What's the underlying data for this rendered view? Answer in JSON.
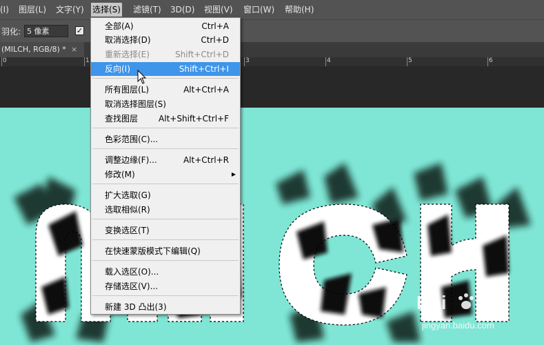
{
  "menubar": {
    "items": [
      "(I)",
      "图层(L)",
      "文字(Y)",
      "选择(S)",
      "滤镜(T)",
      "3D(D)",
      "视图(V)",
      "窗口(W)",
      "帮助(H)"
    ],
    "active": "选择(S)"
  },
  "options": {
    "feather_label": "羽化:",
    "feather_value": "5 像素"
  },
  "tab": {
    "title": "(MILCH, RGB/8) *",
    "close": "×"
  },
  "ruler": {
    "labels": [
      "0",
      "1",
      "2",
      "3",
      "4",
      "5",
      "6"
    ]
  },
  "select_menu": {
    "items": [
      {
        "label": "全部(A)",
        "shortcut": "Ctrl+A"
      },
      {
        "label": "取消选择(D)",
        "shortcut": "Ctrl+D"
      },
      {
        "label": "重新选择(E)",
        "shortcut": "Shift+Ctrl+D"
      },
      {
        "label": "反向(I)",
        "shortcut": "Shift+Ctrl+I"
      },
      {
        "label": "所有图层(L)",
        "shortcut": "Alt+Ctrl+A"
      },
      {
        "label": "取消选择图层(S)",
        "shortcut": ""
      },
      {
        "label": "查找图层",
        "shortcut": "Alt+Shift+Ctrl+F"
      },
      {
        "label": "色彩范围(C)...",
        "shortcut": ""
      },
      {
        "label": "调整边缘(F)...",
        "shortcut": "Alt+Ctrl+R"
      },
      {
        "label": "修改(M)",
        "shortcut": ""
      },
      {
        "label": "扩大选取(G)",
        "shortcut": ""
      },
      {
        "label": "选取相似(R)",
        "shortcut": ""
      },
      {
        "label": "变换选区(T)",
        "shortcut": ""
      },
      {
        "label": "在快速蒙版模式下编辑(Q)",
        "shortcut": ""
      },
      {
        "label": "载入选区(O)...",
        "shortcut": ""
      },
      {
        "label": "存储选区(V)...",
        "shortcut": ""
      },
      {
        "label": "新建 3D 凸出(3)",
        "shortcut": ""
      }
    ],
    "highlighted": "反向(I)",
    "disabled": [
      "重新选择(E)"
    ]
  },
  "watermark": {
    "brand": "Bai",
    "brand2": "经验",
    "url": "jingyan.baidu.com"
  },
  "colors": {
    "menubar": "#535353",
    "canvas": "#7fe6d5",
    "highlight": "#3e95ea",
    "menu_bg": "#f0f0f0"
  },
  "icons": [
    "checkbox-icon",
    "close-icon",
    "submenu-arrow-icon",
    "mouse-cursor-icon",
    "baidu-paw-icon"
  ]
}
